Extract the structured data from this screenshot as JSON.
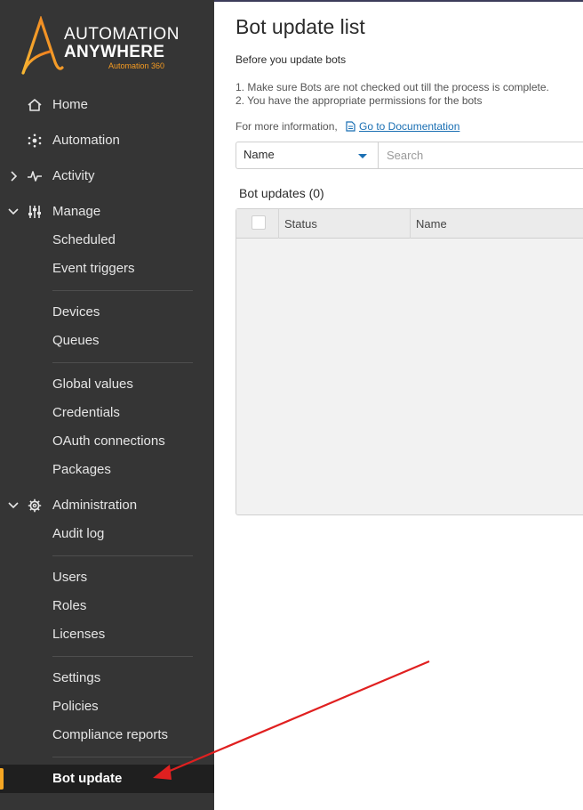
{
  "brand": {
    "line1": "AUTOMATION",
    "line2": "ANYWHERE",
    "tagline": "Automation 360",
    "accent": "#f5a623"
  },
  "sidebar": {
    "items": [
      {
        "label": "Home",
        "icon": "home-icon"
      },
      {
        "label": "Automation",
        "icon": "automation-icon"
      },
      {
        "label": "Activity",
        "icon": "activity-icon",
        "expanded": false
      },
      {
        "label": "Manage",
        "icon": "manage-sliders-icon",
        "expanded": true
      },
      {
        "label": "Scheduled"
      },
      {
        "label": "Event triggers"
      },
      {
        "label": "Devices"
      },
      {
        "label": "Queues"
      },
      {
        "label": "Global values"
      },
      {
        "label": "Credentials"
      },
      {
        "label": "OAuth connections"
      },
      {
        "label": "Packages"
      },
      {
        "label": "Administration",
        "icon": "gear-icon",
        "expanded": true
      },
      {
        "label": "Audit log"
      },
      {
        "label": "Users"
      },
      {
        "label": "Roles"
      },
      {
        "label": "Licenses"
      },
      {
        "label": "Settings"
      },
      {
        "label": "Policies"
      },
      {
        "label": "Compliance reports"
      },
      {
        "label": "Bot update",
        "active": true
      }
    ]
  },
  "main": {
    "title": "Bot update list",
    "intro": "Before you update bots",
    "steps": [
      "1. Make sure Bots are not checked out till the process is complete.",
      "2. You have the appropriate permissions for the bots"
    ],
    "more_info": "For more information,",
    "doc_link": "Go to Documentation",
    "filter": {
      "selected": "Name",
      "placeholder": "Search"
    },
    "table": {
      "title": "Bot updates (0)",
      "columns": [
        "Status",
        "Name"
      ],
      "rows": []
    }
  },
  "annotation": {
    "arrow_color": "#e02020"
  }
}
